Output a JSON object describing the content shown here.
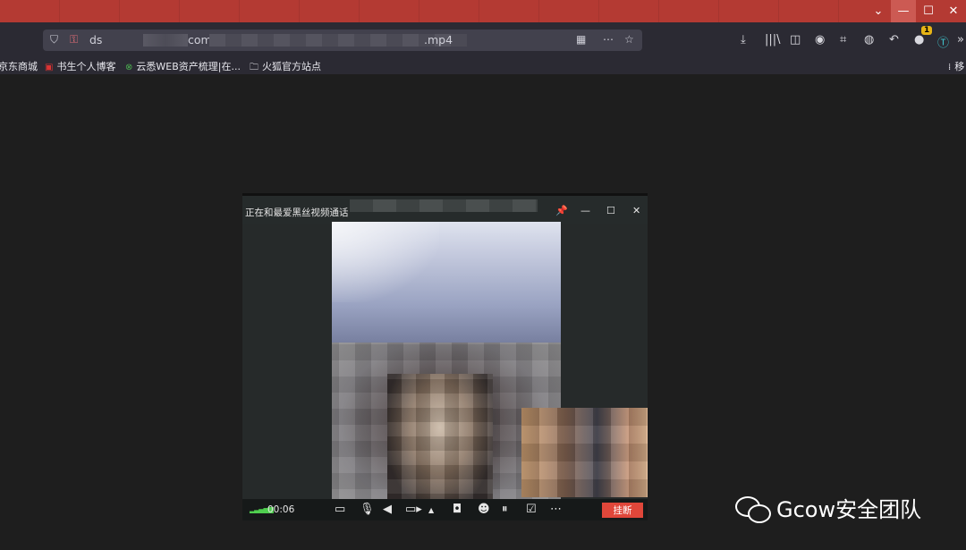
{
  "browser": {
    "url_prefix": "ds",
    "url_mid": "com,",
    "url_suffix": ".mp4",
    "window_controls": {
      "minimize": "—",
      "maximize": "☐",
      "close": "✕",
      "tab_list": "⌄"
    },
    "toolbar_badge": "1",
    "bookmarks": [
      "京东商城",
      "书生个人博客",
      "云悉WEB资产梳理|在...",
      "火狐官方站点"
    ],
    "bookmark_right": "移"
  },
  "call": {
    "title": "正在和最爱黑丝视频通话",
    "timer": "00:06",
    "hangup_label": "挂断",
    "signal": "▂▃▄▅▆"
  },
  "watermark": {
    "text": "Gcow安全团队"
  },
  "colors": {
    "titlebar": "#b43a33",
    "hangup": "#e0473a",
    "background": "#1e1e1e"
  }
}
